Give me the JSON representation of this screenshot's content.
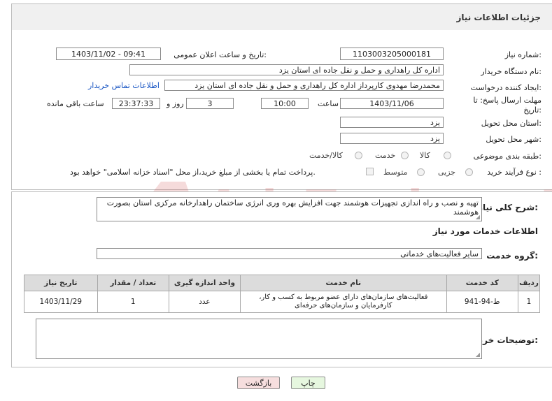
{
  "header": {
    "title": "جزئیات اطلاعات نیاز"
  },
  "fields": {
    "need_number_label": "شماره نیاز:",
    "need_number": "1103003205000181",
    "announce_label": "تاریخ و ساعت اعلان عمومی:",
    "announce_value": "1403/11/02 - 09:41",
    "buyer_org_label": "نام دستگاه خریدار:",
    "buyer_org": "اداره کل راهداری و حمل و نقل جاده ای استان یزد",
    "requester_label": "ایجاد کننده درخواست:",
    "requester": "محمدرضا مهدوی کارپرداز اداره کل راهداری و حمل و نقل جاده ای استان یزد",
    "contact_link": "اطلاعات تماس خریدار",
    "deadline_label_1": "مهلت ارسال پاسخ: تا",
    "deadline_label_2": "تاریخ:",
    "deadline_date": "1403/11/06",
    "time_label": "ساعت",
    "deadline_time": "10:00",
    "days_value": "3",
    "days_label": "روز و",
    "remaining_value": "23:37:33",
    "remaining_label": "ساعت باقی مانده",
    "province_label": "استان محل تحویل:",
    "province": "یزد",
    "city_label": "شهر محل تحویل:",
    "city": "یزد",
    "category_label": "طبقه بندی موضوعی:",
    "category_options": [
      "کالا",
      "خدمت",
      "کالا/خدمت"
    ],
    "process_label": "نوع فرآیند خرید :",
    "process_options": [
      "جزیی",
      "متوسط"
    ],
    "payment_note": "پرداخت تمام یا بخشی از مبلغ خرید،از محل \"اسناد خزانه اسلامی\" خواهد بود."
  },
  "summary": {
    "label": "شرح کلی نیاز:",
    "text": "تهیه و نصب و راه اندازی تجهیزات هوشمند جهت افزایش بهره وری انرژی ساختمان راهدارخانه مرکزی استان بصورت هوشمند"
  },
  "services": {
    "section_title": "اطلاعات خدمات مورد نیاز",
    "group_label": "گروه خدمت:",
    "group_value": "سایر فعالیت‌های خدماتی",
    "columns": [
      "ردیف",
      "کد خدمت",
      "نام خدمت",
      "واحد اندازه گیری",
      "تعداد / مقدار",
      "تاریخ نیاز"
    ],
    "rows": [
      {
        "index": "1",
        "code": "ط-94-941",
        "name": "فعالیت‌های سازمان‌های دارای عضو مربوط به کسب و کار، کارفرمایان و سازمان‌های حرفه‌ای",
        "unit": "عدد",
        "qty": "1",
        "date": "1403/11/29"
      }
    ]
  },
  "buyer_notes": {
    "label": "توضیحات خریدار:"
  },
  "buttons": {
    "print": "چاپ",
    "back": "بازگشت"
  },
  "watermark": {
    "text": "AriaTender.neT"
  },
  "colors": {
    "link": "#1b57c4",
    "back_button": "#f6dede",
    "print_button": "#e6f7df",
    "watermark": "#c62828"
  }
}
